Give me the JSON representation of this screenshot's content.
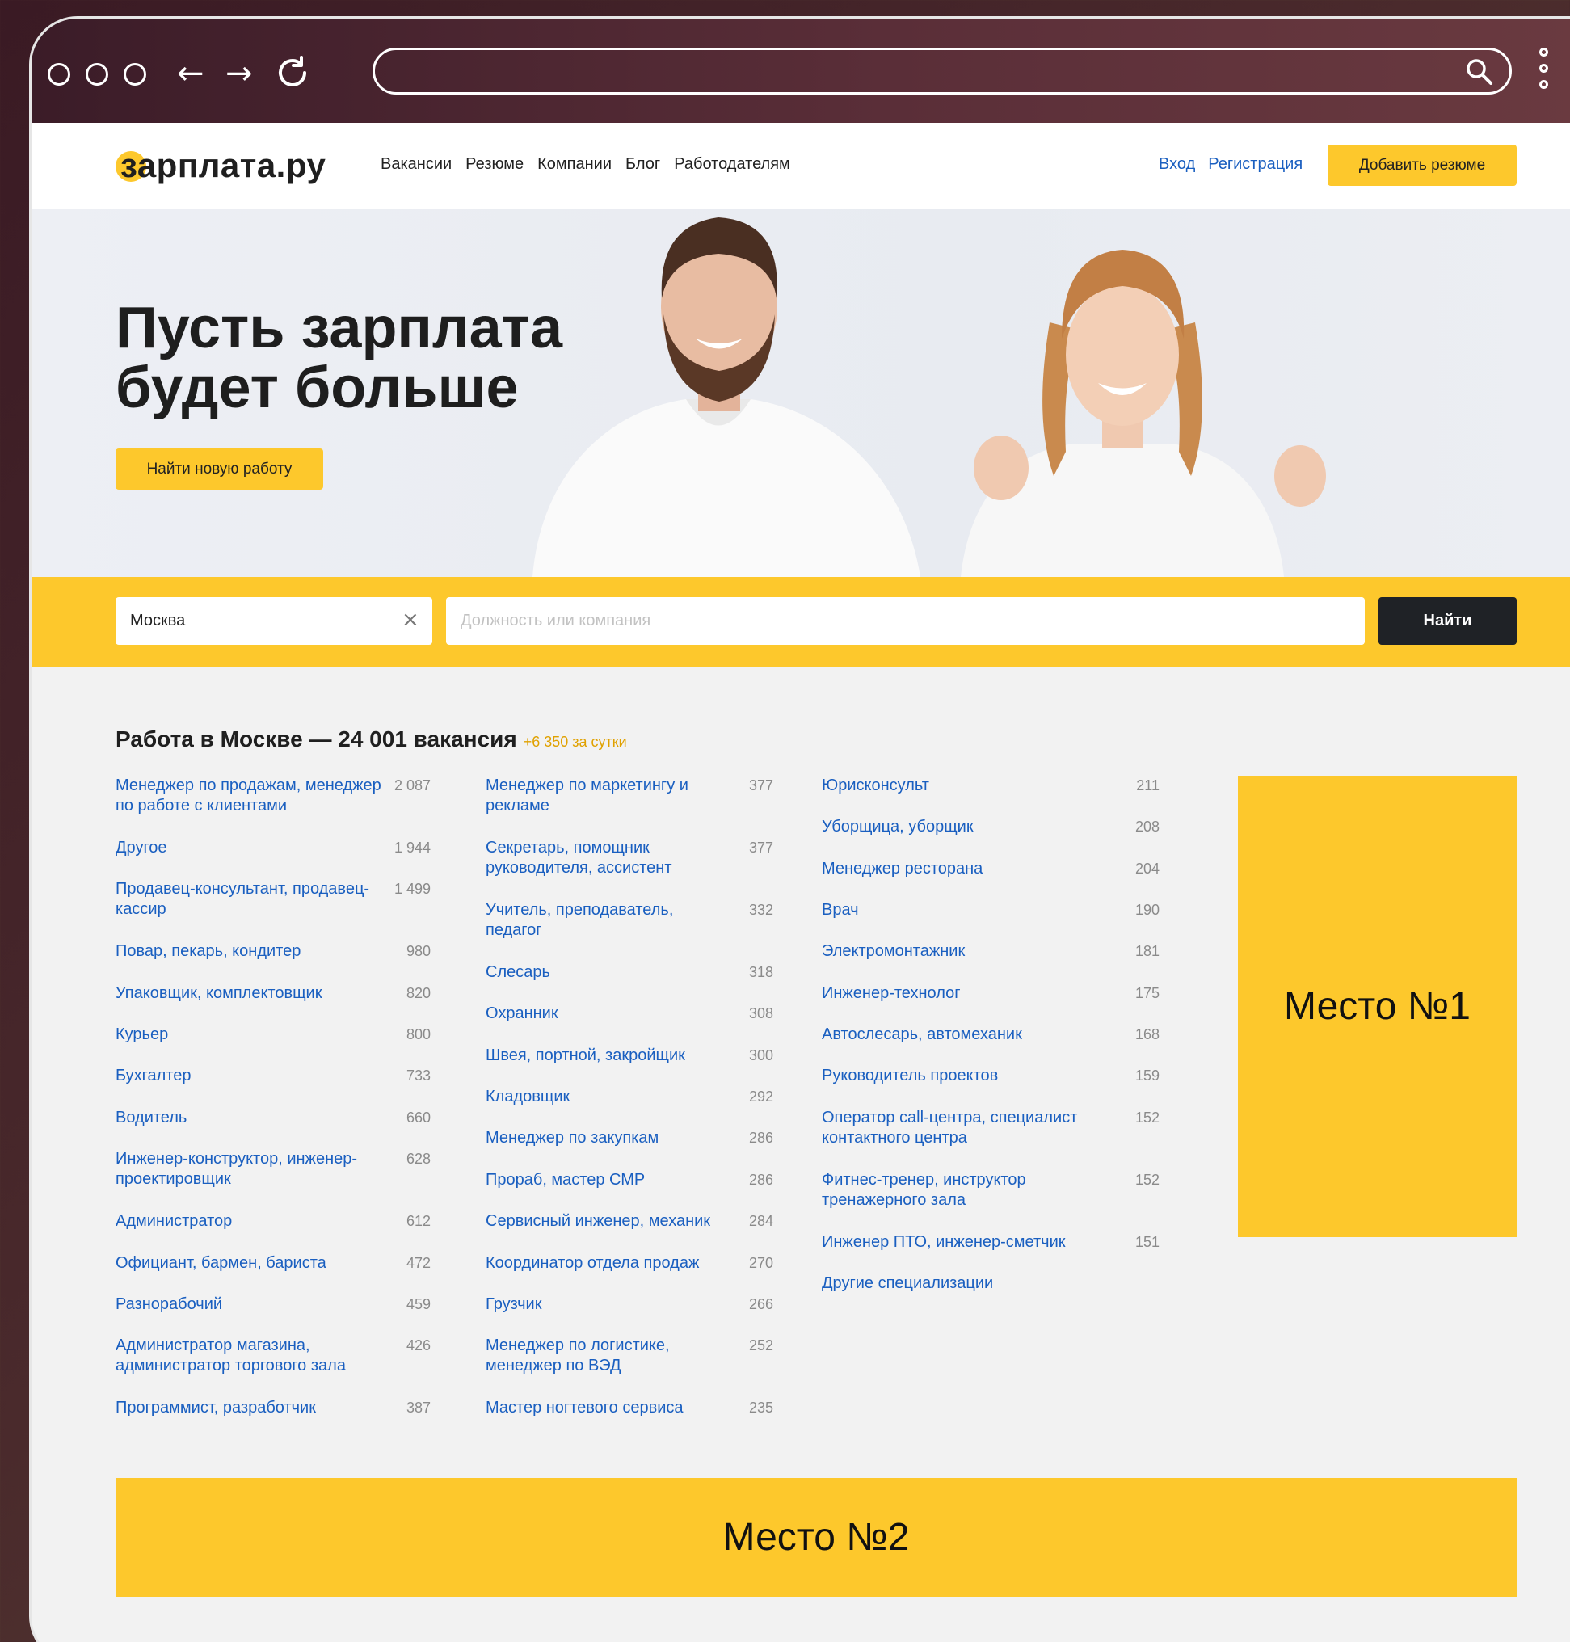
{
  "browser": {
    "url": ""
  },
  "header": {
    "logo": "зарплата.ру",
    "nav": [
      "Вакансии",
      "Резюме",
      "Компании",
      "Блог",
      "Работодателям"
    ],
    "login": "Вход",
    "register": "Регистрация",
    "add_resume": "Добавить резюме"
  },
  "hero": {
    "title_line1": "Пусть зарплата",
    "title_line2": "будет больше",
    "cta": "Найти новую работу"
  },
  "search": {
    "city_value": "Москва",
    "query_placeholder": "Должность или компания",
    "submit": "Найти"
  },
  "listing": {
    "title": "Работа в Москве — 24 001 вакансия",
    "delta": "+6 350 за сутки",
    "col1": [
      {
        "name": "Менеджер по продажам, менеджер по работе с клиентами",
        "count": "2 087"
      },
      {
        "name": "Другое",
        "count": "1 944"
      },
      {
        "name": "Продавец-консультант, продавец-кассир",
        "count": "1 499"
      },
      {
        "name": "Повар, пекарь, кондитер",
        "count": "980"
      },
      {
        "name": "Упаковщик, комплектовщик",
        "count": "820"
      },
      {
        "name": "Курьер",
        "count": "800"
      },
      {
        "name": "Бухгалтер",
        "count": "733"
      },
      {
        "name": "Водитель",
        "count": "660"
      },
      {
        "name": "Инженер-конструктор, инженер-проектировщик",
        "count": "628"
      },
      {
        "name": "Администратор",
        "count": "612"
      },
      {
        "name": "Официант, бармен, бариста",
        "count": "472"
      },
      {
        "name": "Разнорабочий",
        "count": "459"
      },
      {
        "name": "Администратор магазина, администратор торгового зала",
        "count": "426"
      },
      {
        "name": "Программист, разработчик",
        "count": "387"
      }
    ],
    "col2": [
      {
        "name": "Менеджер по маркетингу и рекламе",
        "count": "377"
      },
      {
        "name": "Секретарь, помощник руководителя, ассистент",
        "count": "377"
      },
      {
        "name": "Учитель, преподаватель, педагог",
        "count": "332"
      },
      {
        "name": "Слесарь",
        "count": "318"
      },
      {
        "name": "Охранник",
        "count": "308"
      },
      {
        "name": "Швея, портной, закройщик",
        "count": "300"
      },
      {
        "name": "Кладовщик",
        "count": "292"
      },
      {
        "name": "Менеджер по закупкам",
        "count": "286"
      },
      {
        "name": "Прораб, мастер СМР",
        "count": "286"
      },
      {
        "name": "Сервисный инженер, механик",
        "count": "284"
      },
      {
        "name": "Координатор отдела продаж",
        "count": "270"
      },
      {
        "name": "Грузчик",
        "count": "266"
      },
      {
        "name": "Менеджер по логистике, менеджер по ВЭД",
        "count": "252"
      },
      {
        "name": "Мастер ногтевого сервиса",
        "count": "235"
      }
    ],
    "col3": [
      {
        "name": "Юрисконсульт",
        "count": "211"
      },
      {
        "name": "Уборщица, уборщик",
        "count": "208"
      },
      {
        "name": "Менеджер ресторана",
        "count": "204"
      },
      {
        "name": "Врач",
        "count": "190"
      },
      {
        "name": "Электромонтажник",
        "count": "181"
      },
      {
        "name": "Инженер-технолог",
        "count": "175"
      },
      {
        "name": "Автослесарь, автомеханик",
        "count": "168"
      },
      {
        "name": "Руководитель проектов",
        "count": "159"
      },
      {
        "name": "Оператор call-центра, специалист контактного центра",
        "count": "152"
      },
      {
        "name": "Фитнес-тренер, инструктор тренажерного зала",
        "count": "152"
      },
      {
        "name": "Инженер ПТО, инженер-сметчик",
        "count": "151"
      },
      {
        "name": "Другие специализации",
        "count": ""
      }
    ]
  },
  "ads": {
    "place1": "Место №1",
    "place2": "Место №2"
  }
}
